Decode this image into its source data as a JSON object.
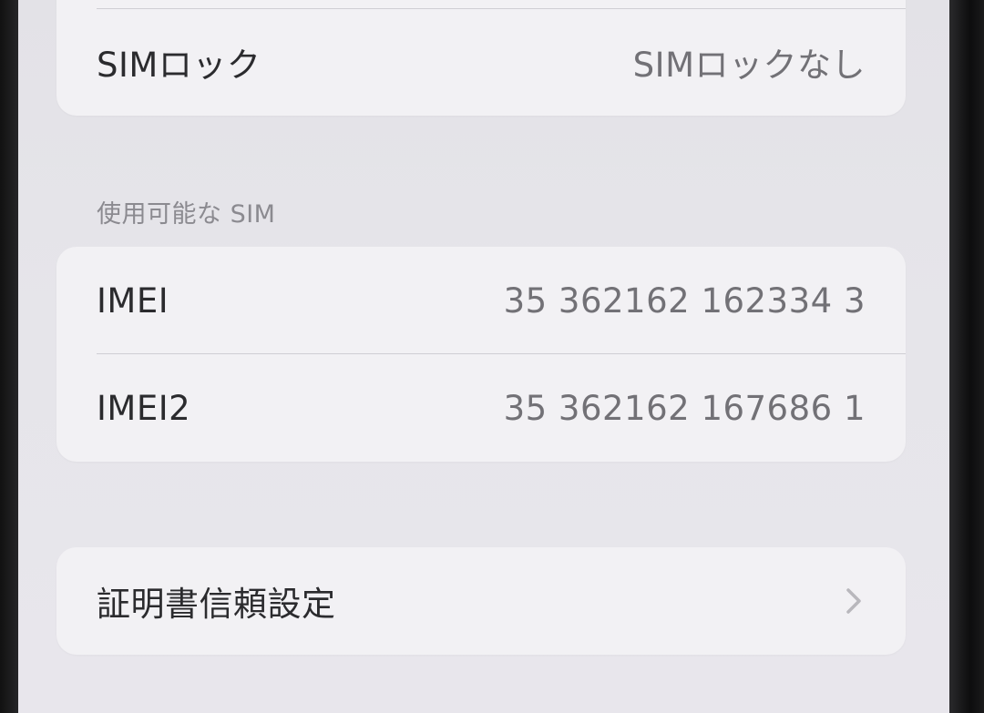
{
  "sim_lock_group": {
    "label": "SIMロック",
    "value": "SIMロックなし"
  },
  "available_sim": {
    "header": "使用可能な SIM",
    "rows": [
      {
        "label": "IMEI",
        "value": "35 362162 162334 3"
      },
      {
        "label": "IMEI2",
        "value": "35 362162 167686 1"
      }
    ]
  },
  "certificate_group": {
    "label": "証明書信頼設定",
    "chevron_icon": "chevron-right-icon"
  },
  "colors": {
    "background": "#e5e4e9",
    "group_background": "#f2f1f4",
    "label_text": "#2b2b2e",
    "value_text": "#727176",
    "header_text": "#8b8a90",
    "chevron": "#b8b7bc"
  }
}
